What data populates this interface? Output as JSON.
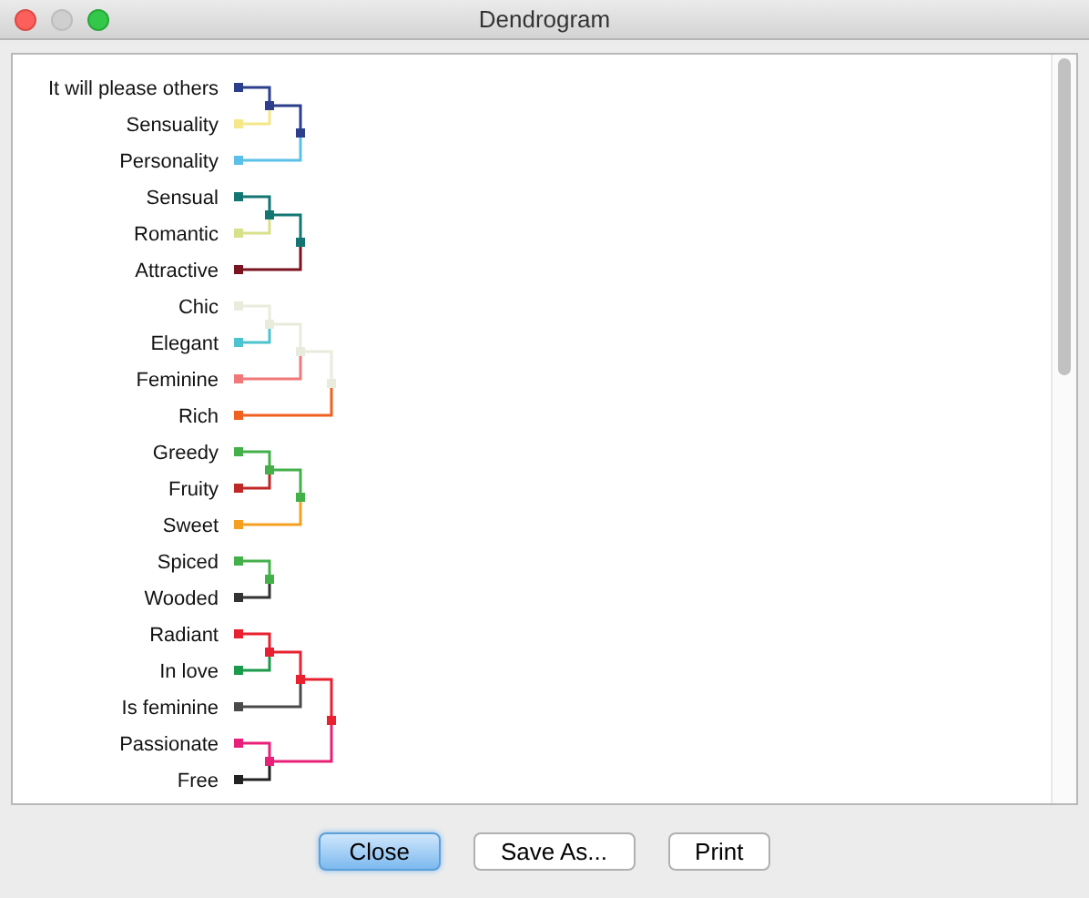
{
  "window": {
    "title": "Dendrogram"
  },
  "dendrogram": {
    "clusters": [
      {
        "color": "#2b3f8c",
        "children": [
          {
            "color": "#2b3f8c",
            "children": [
              {
                "label": "It will please others",
                "color": "#2b3f8c"
              },
              {
                "label": "Sensuality",
                "color": "#f5e88a"
              }
            ]
          },
          {
            "label": "Personality",
            "color": "#5bc0e8"
          }
        ]
      },
      {
        "color": "#137673",
        "children": [
          {
            "color": "#137673",
            "children": [
              {
                "label": "Sensual",
                "color": "#137673"
              },
              {
                "label": "Romantic",
                "color": "#d9e08a"
              }
            ]
          },
          {
            "label": "Attractive",
            "color": "#7a1420"
          }
        ]
      },
      {
        "color": "#e8ecdc",
        "children": [
          {
            "color": "#e8ecdc",
            "children": [
              {
                "color": "#e8ecdc",
                "children": [
                  {
                    "label": "Chic",
                    "color": "#e8ecdc"
                  },
                  {
                    "label": "Elegant",
                    "color": "#4ec3d0"
                  }
                ]
              },
              {
                "label": "Feminine",
                "color": "#f07878"
              }
            ]
          },
          {
            "label": "Rich",
            "color": "#f06020"
          }
        ]
      },
      {
        "color": "#44b04a",
        "children": [
          {
            "color": "#44b04a",
            "children": [
              {
                "label": "Greedy",
                "color": "#44b04a"
              },
              {
                "label": "Fruity",
                "color": "#c02828"
              }
            ]
          },
          {
            "label": "Sweet",
            "color": "#f5a020"
          }
        ]
      },
      {
        "color": "#44b04a",
        "children": [
          {
            "label": "Spiced",
            "color": "#44b04a"
          },
          {
            "label": "Wooded",
            "color": "#333333"
          }
        ]
      },
      {
        "color": "#e82030",
        "children": [
          {
            "color": "#e82030",
            "children": [
              {
                "color": "#e82030",
                "children": [
                  {
                    "label": "Radiant",
                    "color": "#e82030"
                  },
                  {
                    "label": "In love",
                    "color": "#1a9a4a"
                  }
                ]
              },
              {
                "label": "Is feminine",
                "color": "#4a4a4a"
              }
            ]
          },
          {
            "color": "#e82078",
            "children": [
              {
                "label": "Passionate",
                "color": "#e82078"
              },
              {
                "label": "Free",
                "color": "#222222"
              }
            ]
          }
        ]
      }
    ]
  },
  "buttons": [
    {
      "label": "Close",
      "default": true
    },
    {
      "label": "Save As...",
      "default": false
    },
    {
      "label": "Print",
      "default": false
    }
  ]
}
